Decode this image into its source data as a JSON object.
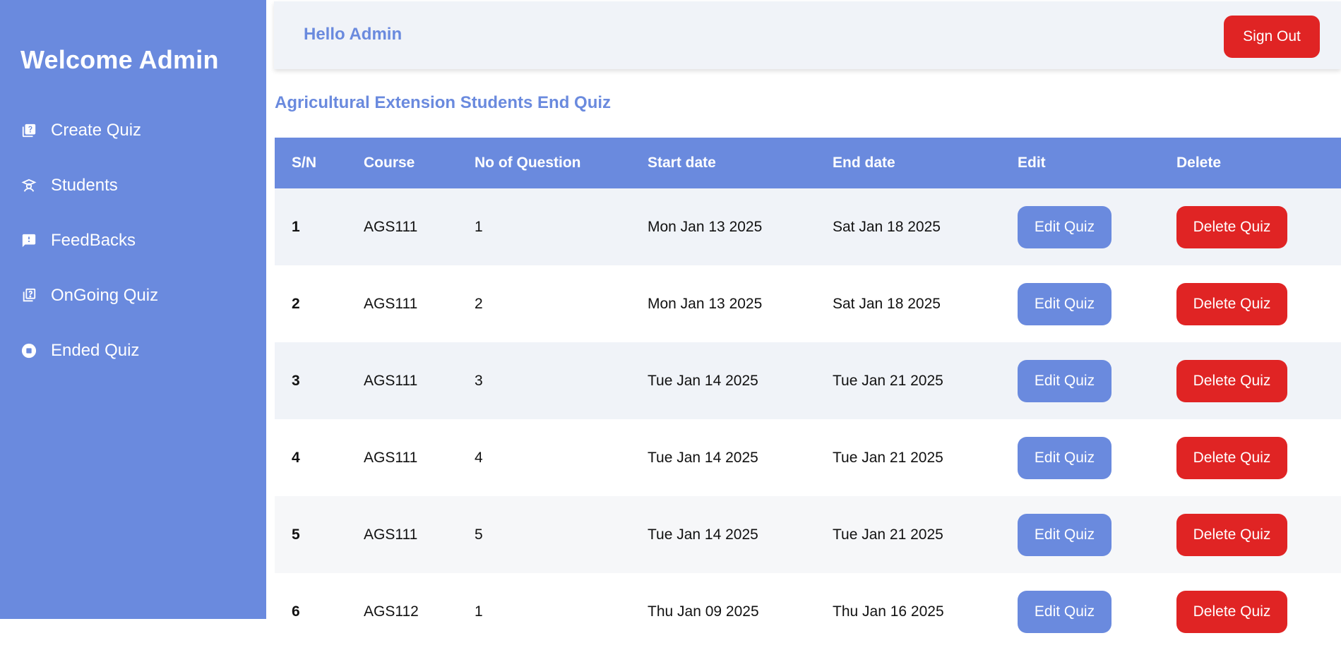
{
  "sidebar": {
    "title": "Welcome Admin",
    "items": [
      {
        "label": "Create Quiz",
        "icon": "quiz-icon"
      },
      {
        "label": "Students",
        "icon": "student-icon"
      },
      {
        "label": "FeedBacks",
        "icon": "feedback-icon"
      },
      {
        "label": "OnGoing Quiz",
        "icon": "ongoing-quiz-icon"
      },
      {
        "label": "Ended Quiz",
        "icon": "stop-circle-icon"
      }
    ]
  },
  "header": {
    "greeting": "Hello Admin",
    "signout_label": "Sign Out"
  },
  "main": {
    "title": "Agricultural Extension Students End Quiz",
    "columns": [
      "S/N",
      "Course",
      "No of Question",
      "Start date",
      "End date",
      "Edit",
      "Delete"
    ],
    "edit_label": "Edit Quiz",
    "delete_label": "Delete Quiz",
    "rows": [
      {
        "sn": "1",
        "course": "AGS111",
        "questions": "1",
        "start": "Mon Jan 13 2025",
        "end": "Sat Jan 18 2025"
      },
      {
        "sn": "2",
        "course": "AGS111",
        "questions": "2",
        "start": "Mon Jan 13 2025",
        "end": "Sat Jan 18 2025"
      },
      {
        "sn": "3",
        "course": "AGS111",
        "questions": "3",
        "start": "Tue Jan 14 2025",
        "end": "Tue Jan 21 2025"
      },
      {
        "sn": "4",
        "course": "AGS111",
        "questions": "4",
        "start": "Tue Jan 14 2025",
        "end": "Tue Jan 21 2025"
      },
      {
        "sn": "5",
        "course": "AGS111",
        "questions": "5",
        "start": "Tue Jan 14 2025",
        "end": "Tue Jan 21 2025"
      },
      {
        "sn": "6",
        "course": "AGS112",
        "questions": "1",
        "start": "Thu Jan 09 2025",
        "end": "Thu Jan 16 2025"
      }
    ]
  },
  "colors": {
    "accent": "#6a8ade",
    "danger": "#e02424",
    "row_alt": "#f0f3f8"
  }
}
